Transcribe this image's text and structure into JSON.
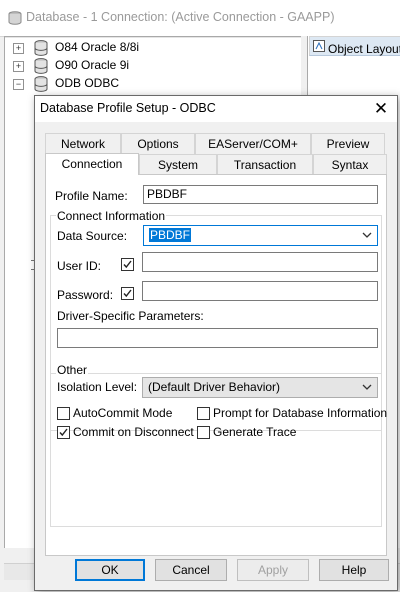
{
  "app": {
    "title": "Database - 1 Connection: (Active Connection - GAAPP)",
    "tree_items": [
      {
        "label": "O84 Oracle 8/8i"
      },
      {
        "label": "O90 Oracle 9i"
      },
      {
        "label": "ODB ODBC"
      }
    ],
    "right_tab_label": "Object Layout (D"
  },
  "dialog": {
    "title": "Database Profile Setup - ODBC",
    "tabs_row1": [
      "Network",
      "Options",
      "EAServer/COM+",
      "Preview"
    ],
    "tabs_row2": [
      "Connection",
      "System",
      "Transaction",
      "Syntax"
    ],
    "active_tab": "Connection",
    "profile_name_label": "Profile Name:",
    "profile_name_value": "PBDBF",
    "connect_info_label": "Connect Information",
    "data_source_label": "Data Source:",
    "data_source_value": "PBDBF",
    "user_id_label": "User ID:",
    "user_id_checked": true,
    "user_id_value": "",
    "password_label": "Password:",
    "password_checked": true,
    "password_value": "",
    "driver_params_label": "Driver-Specific Parameters:",
    "driver_params_value": "",
    "other_label": "Other",
    "isolation_label": "Isolation Level:",
    "isolation_value": "(Default Driver Behavior)",
    "checkboxes": [
      {
        "label": "AutoCommit Mode",
        "checked": false
      },
      {
        "label": "Commit on Disconnect",
        "checked": true
      },
      {
        "label": "Prompt for Database Information",
        "checked": false
      },
      {
        "label": "Generate Trace",
        "checked": false
      }
    ],
    "buttons": {
      "ok": "OK",
      "cancel": "Cancel",
      "apply": "Apply",
      "help": "Help"
    },
    "colors": {
      "selection": "#0078d7",
      "default_button_border": "#0078d7"
    }
  }
}
